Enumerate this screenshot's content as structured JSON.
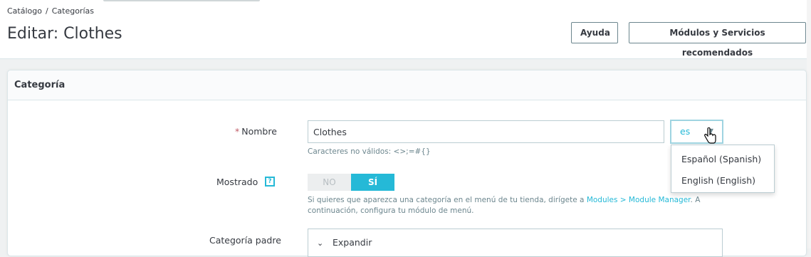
{
  "breadcrumb": {
    "items": [
      "Catálogo",
      "Categorías"
    ],
    "separator": "/"
  },
  "page_title": "Editar: Clothes",
  "header_buttons": {
    "help": "Ayuda",
    "modules": "Módulos y Servicios recomendados"
  },
  "panel": {
    "title": "Categoría"
  },
  "fields": {
    "name": {
      "label": "Nombre",
      "required_mark": "*",
      "value": "Clothes",
      "hint": "Caracteres no válidos: <>;=#{}",
      "language": {
        "selected": "es",
        "options": [
          "Español (Spanish)",
          "English (English)"
        ]
      }
    },
    "displayed": {
      "label": "Mostrado",
      "help_mark": "?",
      "off_label": "NO",
      "on_label": "SÍ",
      "hint_before": "Si quieres que aparezca una categoría en el menú de tu tienda, dirígete a ",
      "hint_link": "Modules > Module Manager",
      "hint_after": ". A continuación, configura tu módulo de menú."
    },
    "parent": {
      "label": "Categoría padre",
      "expand_label": "Expandir"
    }
  },
  "colors": {
    "accent": "#25b9d7",
    "text": "#363a41",
    "muted": "#6c868e",
    "required": "#c05c67"
  },
  "icons": {
    "lang_chevron": "chevron-down-icon",
    "tree_chevron": "chevron-down-icon",
    "cursor": "hand-pointer-icon"
  }
}
